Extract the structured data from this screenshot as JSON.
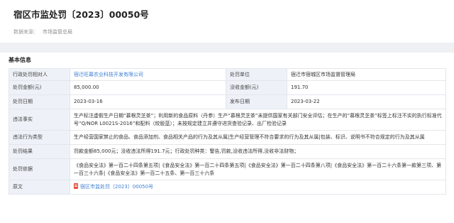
{
  "header": {
    "title": "宿区市监处罚〔2023〕00050号",
    "source_label": "数据来源：",
    "source_value": "市场监管总局"
  },
  "section": {
    "title": "基本信息"
  },
  "fields": {
    "party": {
      "label": "行政处罚相对人",
      "value": "宿迁旺幕农业科技开发有限公司"
    },
    "unit": {
      "label": "处罚单位",
      "value": "宿迁市宿城区市场监督管理局"
    },
    "fine": {
      "label": "处罚金额(元)",
      "value": "85,000.00"
    },
    "confiscation": {
      "label": "没收金额(元)",
      "value": "191.70"
    },
    "penalty_date": {
      "label": "处罚日期",
      "value": "2023-03-16"
    },
    "publish_date": {
      "label": "发布日期",
      "value": "2023-03-22"
    },
    "facts": {
      "label": "违法事实",
      "value": "生产标注虚假生产日期“慕根灵芝茶”；利用新的食品原料（丹参）生产“慕根灵芝茶”未提供国家有关部门安全评估；在生产的“慕根灵芝茶”标签上标注不实的执行标准代号“Q/NOR L0021S-2016”和配料（绞股蓝）；未按规定建立并遵守进货查验记录、出厂检验记录"
    },
    "violation_type": {
      "label": "违法行为类型",
      "value": "生产经营国家禁止的食品、食品添加剂、食品相关产品的行为及其从属|生产经营管理不符合要求的行为及其从属|包装、标识、说明书不符合规定的行为及其从属"
    },
    "result": {
      "label": "处罚结果",
      "value": "罚款金额85,000元；没收违法所得191.7元；行政处罚种类：警告,罚款,没收违法所得,没收非法财物；"
    },
    "basis": {
      "label": "处罚依据",
      "value": "《食品安全法》第一百二十四条第五项|《食品安全法》第一百二十四条第五项|《食品安全法》第一百二十四条第八项|《食品安全法》第一百二十六条第一款第三项、第一百三十六条|《食品安全法》第一百二十五条、第一百三十六条"
    },
    "original": {
      "label": "原文",
      "value": "宿区市监处罚〔2023〕00050号"
    }
  },
  "colors": {
    "label_bg": "#eef2f8",
    "link": "#3d7fd1",
    "border": "#e3e6eb",
    "page_bg": "#eef0f4"
  }
}
